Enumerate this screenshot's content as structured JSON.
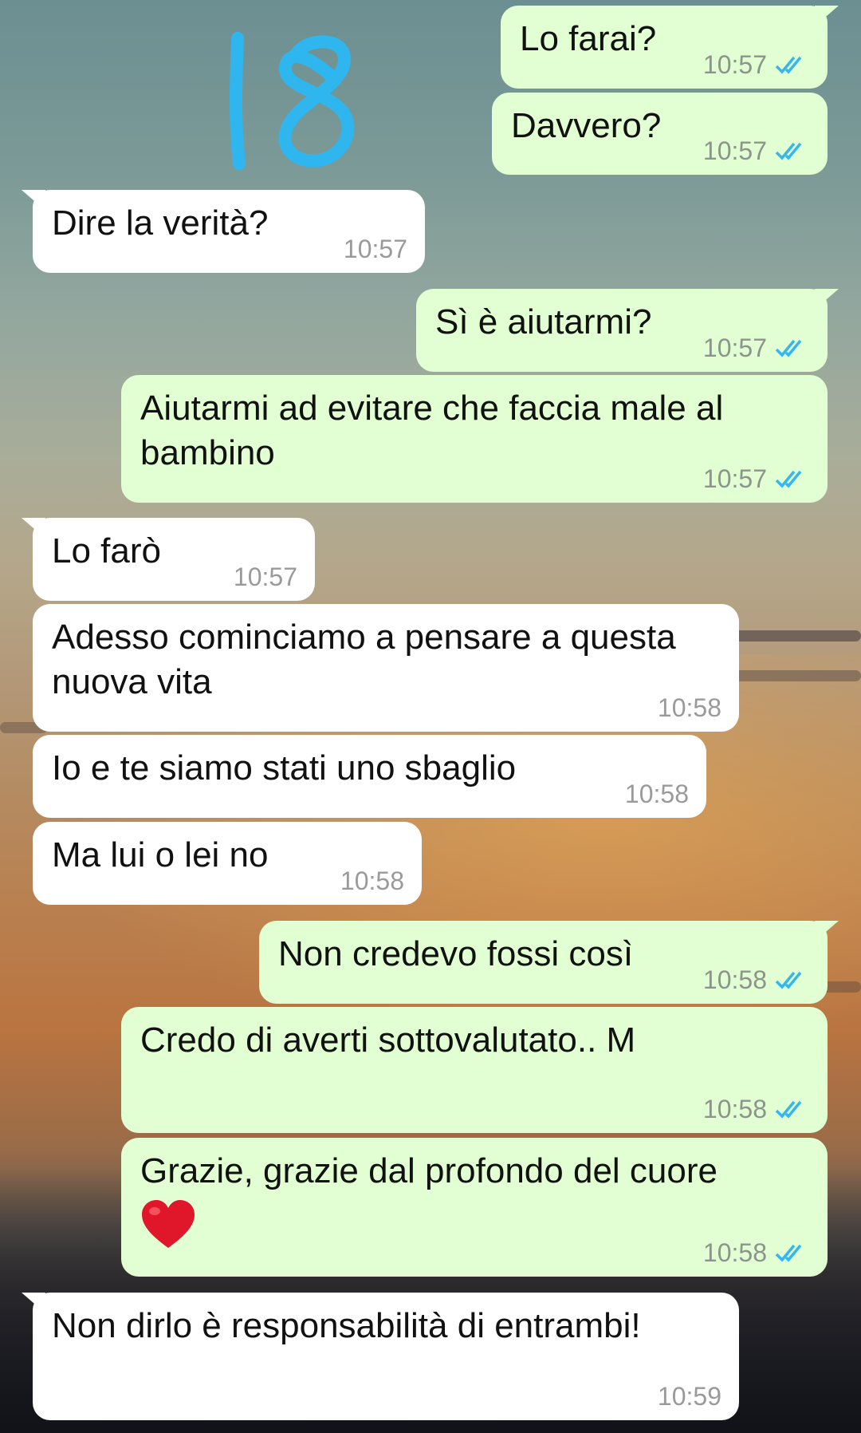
{
  "overlay": {
    "number": "18"
  },
  "colors": {
    "outgoing_bubble": "#e2ffd3",
    "incoming_bubble": "#ffffff",
    "read_ticks": "#34b7f1",
    "annotation": "#2fb6ee"
  },
  "messages": [
    {
      "text": "Lo farai?",
      "time": "10:57",
      "direction": "outgoing",
      "status": "read"
    },
    {
      "text": "Davvero?",
      "time": "10:57",
      "direction": "outgoing",
      "status": "read"
    },
    {
      "text": "Dire la verità?",
      "time": "10:57",
      "direction": "incoming"
    },
    {
      "text": "Sì è aiutarmi?",
      "time": "10:57",
      "direction": "outgoing",
      "status": "read"
    },
    {
      "text": "Aiutarmi ad evitare che faccia male al bambino",
      "time": "10:57",
      "direction": "outgoing",
      "status": "read"
    },
    {
      "text": "Lo farò",
      "time": "10:57",
      "direction": "incoming"
    },
    {
      "text": "Adesso cominciamo a pensare a questa nuova vita",
      "time": "10:58",
      "direction": "incoming"
    },
    {
      "text": "Io e te siamo stati uno sbaglio",
      "time": "10:58",
      "direction": "incoming"
    },
    {
      "text": "Ma lui o lei no",
      "time": "10:58",
      "direction": "incoming"
    },
    {
      "text": "Non credevo fossi così",
      "time": "10:58",
      "direction": "outgoing",
      "status": "read"
    },
    {
      "text": "Credo di averti sottovalutato.. M",
      "time": "10:58",
      "direction": "outgoing",
      "status": "read"
    },
    {
      "text": "Grazie, grazie dal profondo del cuore",
      "emoji": "heart",
      "time": "10:58",
      "direction": "outgoing",
      "status": "read"
    },
    {
      "text": "Non dirlo è responsabilità di entrambi!",
      "time": "10:59",
      "direction": "incoming"
    }
  ]
}
